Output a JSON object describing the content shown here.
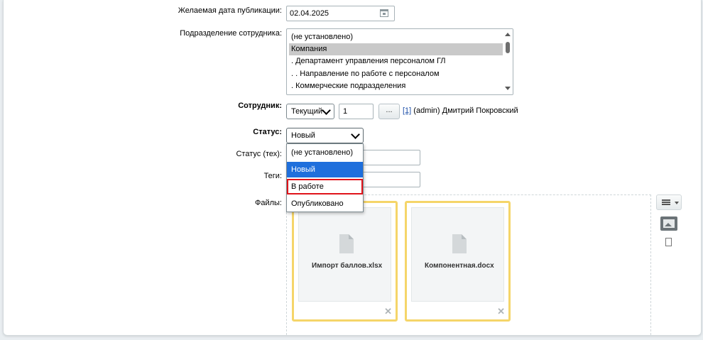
{
  "form": {
    "pub_date": {
      "label": "Желаемая дата публикации:",
      "value": "02.04.2025"
    },
    "department": {
      "label": "Подразделение сотрудника:",
      "options": [
        "(не установлено)",
        "Компания",
        ". Департамент управления персоналом ГЛ",
        ". . Направление по работе с персоналом",
        ". Коммерческие подразделения"
      ],
      "selected": "Компания"
    },
    "employee": {
      "label": "Сотрудник:",
      "mode": "Текущий",
      "id": "1",
      "button": "...",
      "link_id": "[1]",
      "name": "(admin) Дмитрий Покровский"
    },
    "status": {
      "label": "Статус:",
      "selected": "Новый",
      "options": [
        "(не установлено)",
        "Новый",
        "В работе",
        "Опубликовано"
      ],
      "highlighted": "Новый",
      "marked": "В работе"
    },
    "status_tech": {
      "label": "Статус (тех):",
      "value": ""
    },
    "tags": {
      "label": "Теги:",
      "value": ""
    },
    "files": {
      "label": "Файлы:",
      "items": [
        {
          "name": "Импорт баллов.xlsx"
        },
        {
          "name": "Компонентная.docx"
        }
      ]
    }
  },
  "colors": {
    "highlight": "#1f6fdc",
    "marker": "#e0131a",
    "file_border": "#f5d569"
  }
}
